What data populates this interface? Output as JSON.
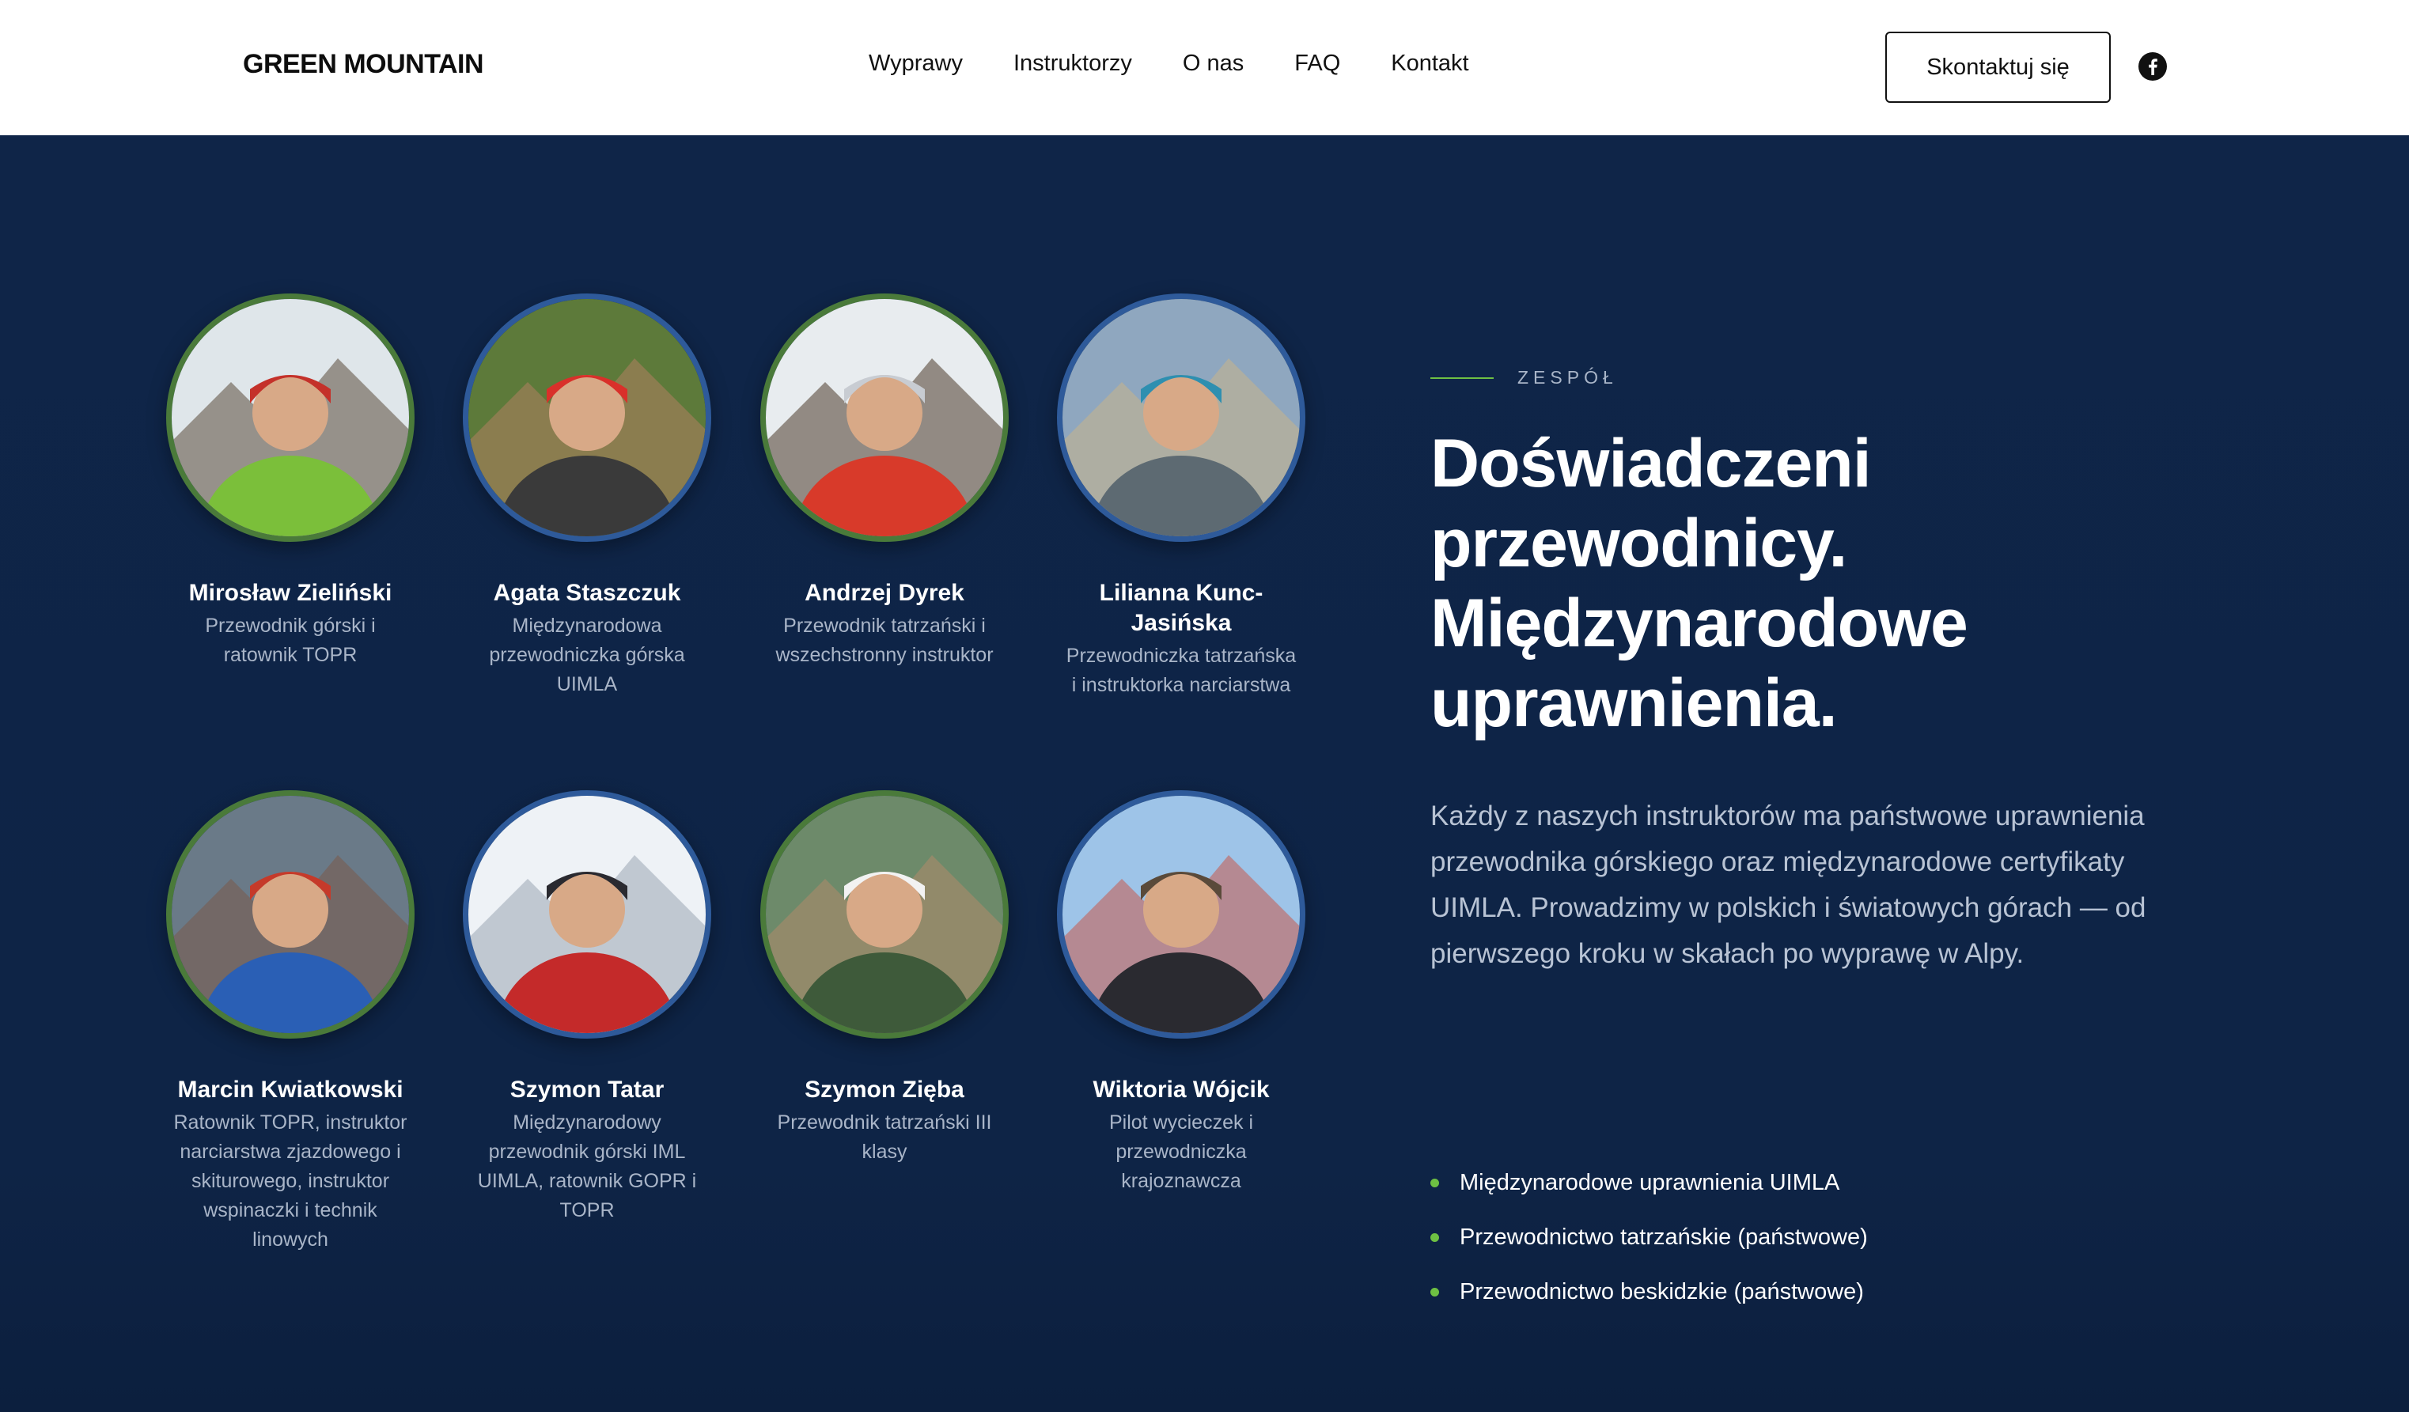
{
  "header": {
    "logo": "GREEN MOUNTAIN",
    "nav": [
      "Wyprawy",
      "Instruktorzy",
      "O nas",
      "FAQ",
      "Kontakt"
    ],
    "cta": "Skontaktuj się",
    "social_icon": "facebook-icon"
  },
  "team": [
    {
      "name": "Mirosław Zieliński",
      "role": "Przewodnik górski i ratownik TOPR",
      "ring": "green"
    },
    {
      "name": "Agata Staszczuk",
      "role": "Międzynarodowa przewodniczka górska UIMLA",
      "ring": "blue"
    },
    {
      "name": "Andrzej Dyrek",
      "role": "Przewodnik tatrzański i wszechstronny instruktor",
      "ring": "green"
    },
    {
      "name": "Lilianna Kunc-Jasińska",
      "role": "Przewodniczka tatrzańska i instruktorka narciarstwa",
      "ring": "blue"
    },
    {
      "name": "Marcin Kwiatkowski",
      "role": "Ratownik TOPR, instruktor narciarstwa zjazdowego i skiturowego, instruktor wspinaczki i technik linowych",
      "ring": "green"
    },
    {
      "name": "Szymon Tatar",
      "role": "Międzynarodowy przewodnik górski IML UIMLA, ratownik GOPR i TOPR",
      "ring": "blue"
    },
    {
      "name": "Szymon Zięba",
      "role": "Przewodnik tatrzański III klasy",
      "ring": "green"
    },
    {
      "name": "Wiktoria Wójcik",
      "role": "Pilot wycieczek i przewodniczka krajoznawcza",
      "ring": "blue"
    }
  ],
  "section": {
    "eyebrow": "ZESPÓŁ",
    "headline": [
      "Doświadczeni",
      "przewodnicy.",
      "Międzynarodowe",
      "uprawnienia."
    ],
    "lead": "Każdy z naszych instruktorów ma państwowe uprawnienia przewodnika górskiego oraz międzynarodowe certyfikaty UIMLA. Prowadzimy w polskich i światowych górach — od pierwszego kroku w skałach po wyprawę w Alpy.",
    "bullets": [
      "Międzynarodowe uprawnienia UIMLA",
      "Przewodnictwo tatrzańskie (państwowe)",
      "Przewodnictwo beskidzkie (państwowe)"
    ]
  },
  "colors": {
    "background": "#0f2548",
    "accent_green": "#6ec043",
    "ring_green": "#4a7a3a",
    "ring_blue": "#2e5a9a"
  }
}
